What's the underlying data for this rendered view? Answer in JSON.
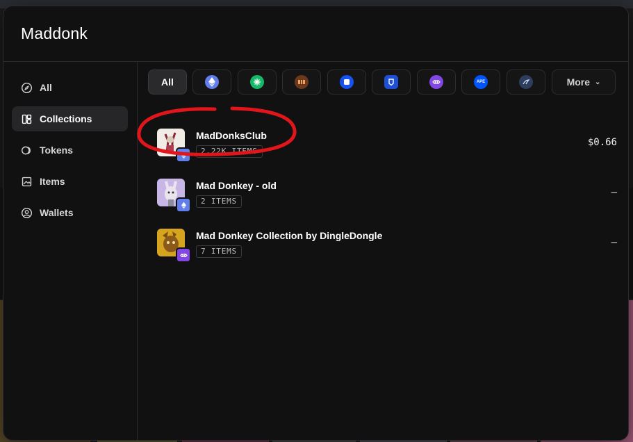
{
  "modal": {
    "title": "Maddonk"
  },
  "sidebar": {
    "items": [
      {
        "label": "All",
        "icon": "compass-icon",
        "active": false
      },
      {
        "label": "Collections",
        "icon": "grid-icon",
        "active": true
      },
      {
        "label": "Tokens",
        "icon": "coins-icon",
        "active": false
      },
      {
        "label": "Items",
        "icon": "image-icon",
        "active": false
      },
      {
        "label": "Wallets",
        "icon": "user-circle-icon",
        "active": false
      }
    ]
  },
  "chain_filters": {
    "all_label": "All",
    "chains": [
      {
        "icon": "ethereum-icon",
        "color": "#627eea"
      },
      {
        "icon": "green-chain-icon",
        "color": "#14b866"
      },
      {
        "icon": "brown-chain-icon",
        "color": "#6b3a1e"
      },
      {
        "icon": "blue-square-chain-icon",
        "color": "#1652f0"
      },
      {
        "icon": "shield-chain-icon",
        "color": "#1d4fd7"
      },
      {
        "icon": "polygon-icon",
        "color": "#8247e5"
      },
      {
        "icon": "ape-icon",
        "color": "#0054fa"
      },
      {
        "icon": "dark-chain-icon",
        "color": "#2c3e5c"
      }
    ],
    "more_label": "More"
  },
  "results": [
    {
      "name": "MadDonksClub",
      "count": "2.22K ITEMS",
      "price": "$0.66",
      "chain": "ethereum-icon"
    },
    {
      "name": "Mad Donkey - old",
      "count": "2 ITEMS",
      "price": "–",
      "chain": "ethereum-icon"
    },
    {
      "name": "Mad Donkey Collection by DingleDongle",
      "count": "7 ITEMS",
      "price": "–",
      "chain": "polygon-icon"
    }
  ],
  "colors": {
    "accent_annotation": "#e0161b",
    "background": "#111112"
  }
}
